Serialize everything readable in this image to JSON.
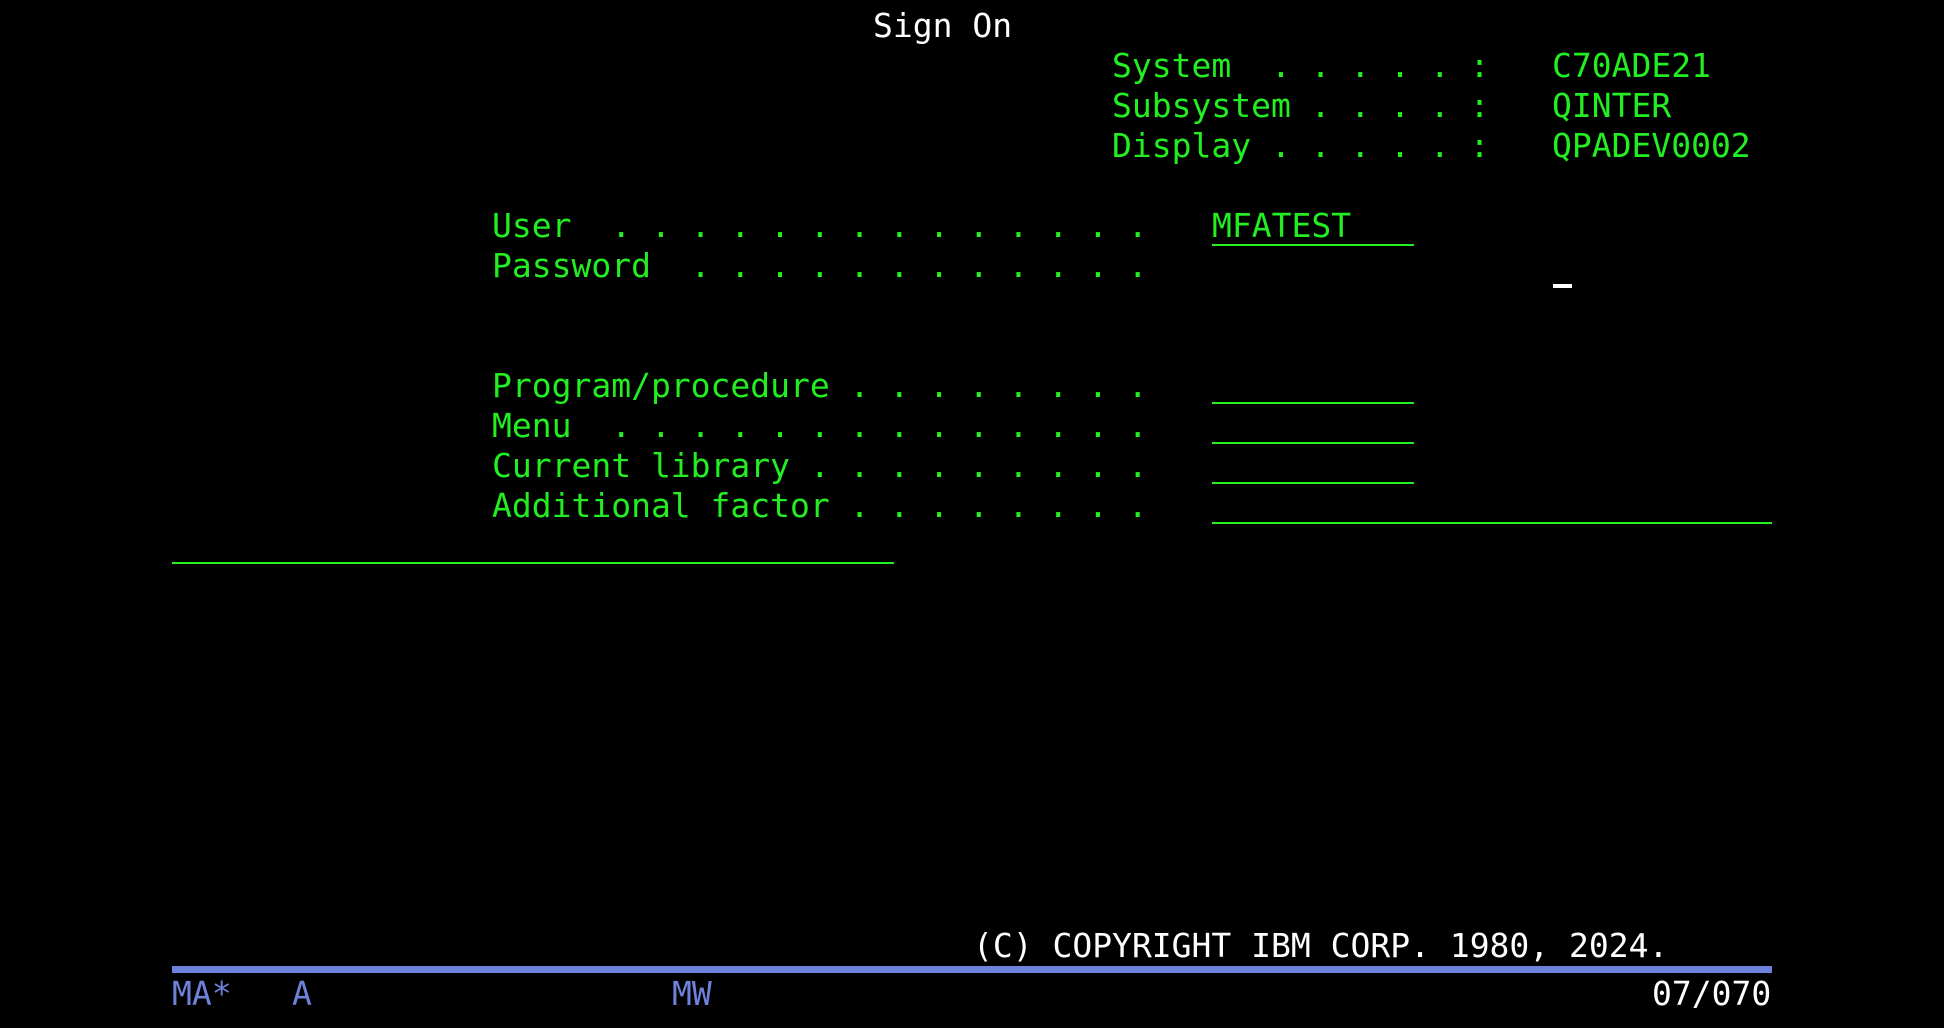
{
  "screen": {
    "title": "Sign On",
    "copyright": "(C) COPYRIGHT IBM CORP. 1980, 2024."
  },
  "system_info": [
    {
      "label": "System  . . . . . :",
      "value": "C70ADE21"
    },
    {
      "label": "Subsystem . . . . :",
      "value": "QINTER"
    },
    {
      "label": "Display . . . . . :",
      "value": "QPADEV0002"
    }
  ],
  "form": {
    "user_label": "User  . . . . . . . . . . . . . .",
    "user_value": "MFATEST",
    "password_label": "Password  . . . . . . . . . . . .",
    "password_value": "",
    "program_label": "Program/procedure . . . . . . . .",
    "program_value": "",
    "menu_label": "Menu  . . . . . . . . . . . . . .",
    "menu_value": "",
    "library_label": "Current library . . . . . . . . .",
    "library_value": "",
    "factor_label": "Additional factor . . . . . . . .",
    "factor_value": ""
  },
  "status_bar": {
    "session": "MA*",
    "indicator": "A",
    "mode": "MW",
    "cursor_position": "07/070"
  },
  "colors": {
    "background": "#000000",
    "field_text": "#22ee22",
    "title_text": "#ffffff",
    "status_text": "#6e82dc"
  }
}
